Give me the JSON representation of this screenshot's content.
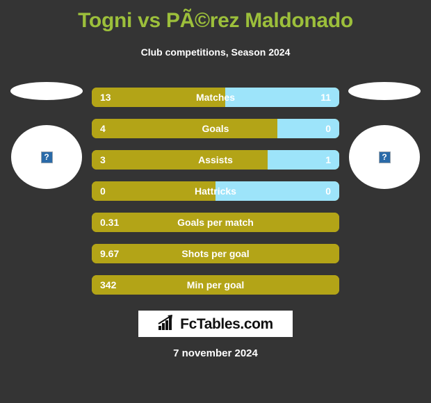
{
  "header": {
    "title": "Togni vs PÃ©rez Maldonado",
    "subtitle": "Club competitions, Season 2024",
    "title_color": "#9cbf3b"
  },
  "players": {
    "home": {
      "flag_alt": "flag",
      "photo_alt": "?"
    },
    "away": {
      "flag_alt": "flag",
      "photo_alt": "?"
    }
  },
  "colors": {
    "background": "#343434",
    "home_bar": "#b3a417",
    "away_bar": "#9de4fa",
    "text": "#ffffff"
  },
  "chart_data": {
    "type": "bar",
    "title": "Togni vs PÃ©rez Maldonado",
    "subtitle": "Club competitions, Season 2024",
    "orientation": "horizontal-diverging",
    "series": [
      {
        "name": "Togni",
        "color": "#b3a417"
      },
      {
        "name": "PÃ©rez Maldonado",
        "color": "#9de4fa"
      }
    ],
    "categories": [
      "Matches",
      "Goals",
      "Assists",
      "Hattricks",
      "Goals per match",
      "Shots per goal",
      "Min per goal"
    ],
    "rows": [
      {
        "label": "Matches",
        "home": "13",
        "away": "11",
        "home_pct": 54,
        "two_sided": true
      },
      {
        "label": "Goals",
        "home": "4",
        "away": "0",
        "home_pct": 75,
        "two_sided": true
      },
      {
        "label": "Assists",
        "home": "3",
        "away": "1",
        "home_pct": 71,
        "two_sided": true
      },
      {
        "label": "Hattricks",
        "home": "0",
        "away": "0",
        "home_pct": 50,
        "two_sided": true
      },
      {
        "label": "Goals per match",
        "home": "0.31",
        "away": "",
        "home_pct": 100,
        "two_sided": false
      },
      {
        "label": "Shots per goal",
        "home": "9.67",
        "away": "",
        "home_pct": 100,
        "two_sided": false
      },
      {
        "label": "Min per goal",
        "home": "342",
        "away": "",
        "home_pct": 100,
        "two_sided": false
      }
    ]
  },
  "footer": {
    "logo_text": "FcTables.com",
    "logo_icon": "bar-chart-arrow-icon",
    "date": "7 november 2024"
  }
}
